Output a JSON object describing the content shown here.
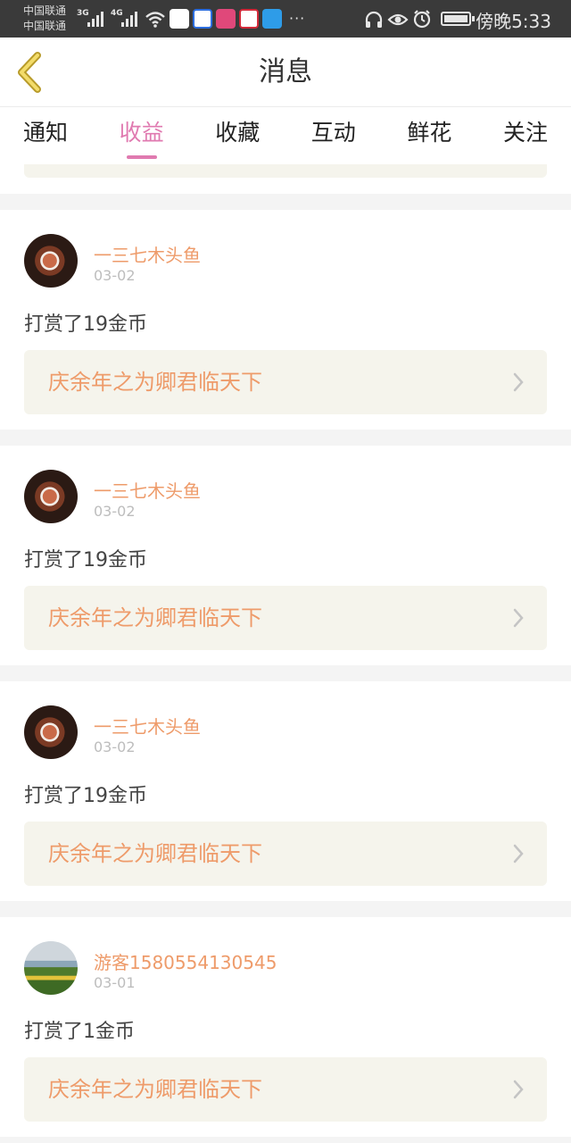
{
  "status_bar": {
    "carrier_1": "中国联通",
    "carrier_2": "中国联通",
    "net_1": "3G",
    "net_2": "4G",
    "time": "傍晚5:33",
    "icons": [
      "wifi-icon",
      "zhihu-app-icon",
      "baidu-app-icon",
      "weibo-app-icon",
      "ctrip-app-icon",
      "blue-app-icon",
      "more-dots-icon",
      "headphone-icon",
      "eye-icon",
      "alarm-icon",
      "battery-icon"
    ]
  },
  "header": {
    "title": "消息",
    "back_icon": "back-chevron-icon"
  },
  "tabs": [
    {
      "label": "通知"
    },
    {
      "label": "收益",
      "active": true
    },
    {
      "label": "收藏"
    },
    {
      "label": "互动"
    },
    {
      "label": "鲜花"
    },
    {
      "label": "关注"
    }
  ],
  "messages": [
    {
      "user": "一三七木头鱼",
      "date": "03-02",
      "action": "打赏了19金币",
      "book": "庆余年之为卿君临天下",
      "avatar": "food-avatar"
    },
    {
      "user": "一三七木头鱼",
      "date": "03-02",
      "action": "打赏了19金币",
      "book": "庆余年之为卿君临天下",
      "avatar": "food-avatar"
    },
    {
      "user": "一三七木头鱼",
      "date": "03-02",
      "action": "打赏了19金币",
      "book": "庆余年之为卿君临天下",
      "avatar": "food-avatar"
    },
    {
      "user": "游客1580554130545",
      "date": "03-01",
      "action": "打赏了1金币",
      "book": "庆余年之为卿君临天下",
      "avatar": "field-avatar"
    }
  ],
  "colors": {
    "accent": "#e07ab0",
    "name_orange": "#ee9b6a",
    "book_bg": "#f5f4ec"
  }
}
